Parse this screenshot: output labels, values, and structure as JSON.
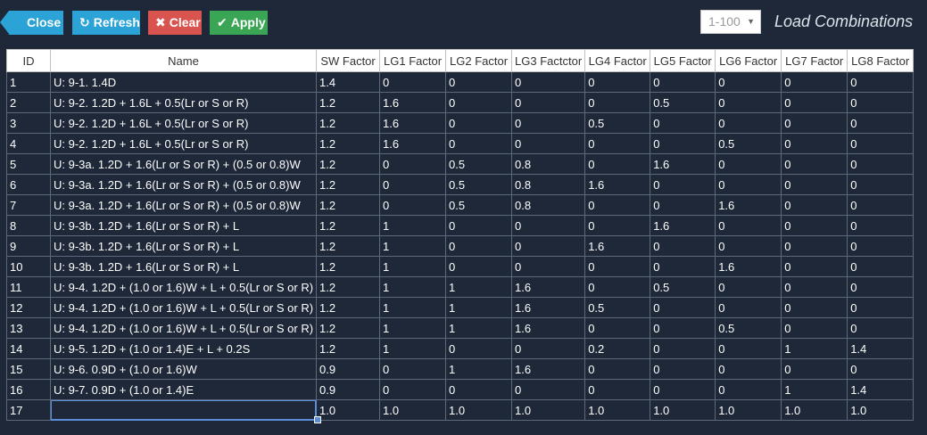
{
  "toolbar": {
    "close_label": "Close",
    "refresh_label": "Refresh",
    "clear_label": "Clear",
    "apply_label": "Apply",
    "range_value": "1-100",
    "title": "Load Combinations",
    "colors": {
      "info": "#2ba3d6",
      "danger": "#d9534f",
      "success": "#3aa655"
    }
  },
  "columns": [
    "ID",
    "Name",
    "SW Factor",
    "LG1 Factor",
    "LG2 Factor",
    "LG3 Factctor",
    "LG4 Factor",
    "LG5 Factor",
    "LG6 Factor",
    "LG7 Factor",
    "LG8 Factor"
  ],
  "rows": [
    [
      "1",
      "U: 9-1. 1.4D",
      "1.4",
      "0",
      "0",
      "0",
      "0",
      "0",
      "0",
      "0",
      "0"
    ],
    [
      "2",
      "U: 9-2. 1.2D + 1.6L + 0.5(Lr or S or R)",
      "1.2",
      "1.6",
      "0",
      "0",
      "0",
      "0.5",
      "0",
      "0",
      "0"
    ],
    [
      "3",
      "U: 9-2. 1.2D + 1.6L + 0.5(Lr or S or R)",
      "1.2",
      "1.6",
      "0",
      "0",
      "0.5",
      "0",
      "0",
      "0",
      "0"
    ],
    [
      "4",
      "U: 9-2. 1.2D + 1.6L + 0.5(Lr or S or R)",
      "1.2",
      "1.6",
      "0",
      "0",
      "0",
      "0",
      "0.5",
      "0",
      "0"
    ],
    [
      "5",
      "U: 9-3a. 1.2D + 1.6(Lr or S or R) + (0.5 or 0.8)W",
      "1.2",
      "0",
      "0.5",
      "0.8",
      "0",
      "1.6",
      "0",
      "0",
      "0"
    ],
    [
      "6",
      "U: 9-3a. 1.2D + 1.6(Lr or S or R) + (0.5 or 0.8)W",
      "1.2",
      "0",
      "0.5",
      "0.8",
      "1.6",
      "0",
      "0",
      "0",
      "0"
    ],
    [
      "7",
      "U: 9-3a. 1.2D + 1.6(Lr or S or R) + (0.5 or 0.8)W",
      "1.2",
      "0",
      "0.5",
      "0.8",
      "0",
      "0",
      "1.6",
      "0",
      "0"
    ],
    [
      "8",
      "U: 9-3b. 1.2D + 1.6(Lr or S or R) + L",
      "1.2",
      "1",
      "0",
      "0",
      "0",
      "1.6",
      "0",
      "0",
      "0"
    ],
    [
      "9",
      "U: 9-3b. 1.2D + 1.6(Lr or S or R) + L",
      "1.2",
      "1",
      "0",
      "0",
      "1.6",
      "0",
      "0",
      "0",
      "0"
    ],
    [
      "10",
      "U: 9-3b. 1.2D + 1.6(Lr or S or R) + L",
      "1.2",
      "1",
      "0",
      "0",
      "0",
      "0",
      "1.6",
      "0",
      "0"
    ],
    [
      "11",
      "U: 9-4. 1.2D + (1.0 or 1.6)W + L + 0.5(Lr or S or R)",
      "1.2",
      "1",
      "1",
      "1.6",
      "0",
      "0.5",
      "0",
      "0",
      "0"
    ],
    [
      "12",
      "U: 9-4. 1.2D + (1.0 or 1.6)W + L + 0.5(Lr or S or R)",
      "1.2",
      "1",
      "1",
      "1.6",
      "0.5",
      "0",
      "0",
      "0",
      "0"
    ],
    [
      "13",
      "U: 9-4. 1.2D + (1.0 or 1.6)W + L + 0.5(Lr or S or R)",
      "1.2",
      "1",
      "1",
      "1.6",
      "0",
      "0",
      "0.5",
      "0",
      "0"
    ],
    [
      "14",
      "U: 9-5. 1.2D + (1.0 or 1.4)E + L + 0.2S",
      "1.2",
      "1",
      "0",
      "0",
      "0.2",
      "0",
      "0",
      "1",
      "1.4"
    ],
    [
      "15",
      "U: 9-6. 0.9D + (1.0 or 1.6)W",
      "0.9",
      "0",
      "1",
      "1.6",
      "0",
      "0",
      "0",
      "0",
      "0"
    ],
    [
      "16",
      "U: 9-7. 0.9D + (1.0 or 1.4)E",
      "0.9",
      "0",
      "0",
      "0",
      "0",
      "0",
      "0",
      "1",
      "1.4"
    ],
    [
      "17",
      "",
      "1.0",
      "1.0",
      "1.0",
      "1.0",
      "1.0",
      "1.0",
      "1.0",
      "1.0",
      "1.0"
    ]
  ]
}
